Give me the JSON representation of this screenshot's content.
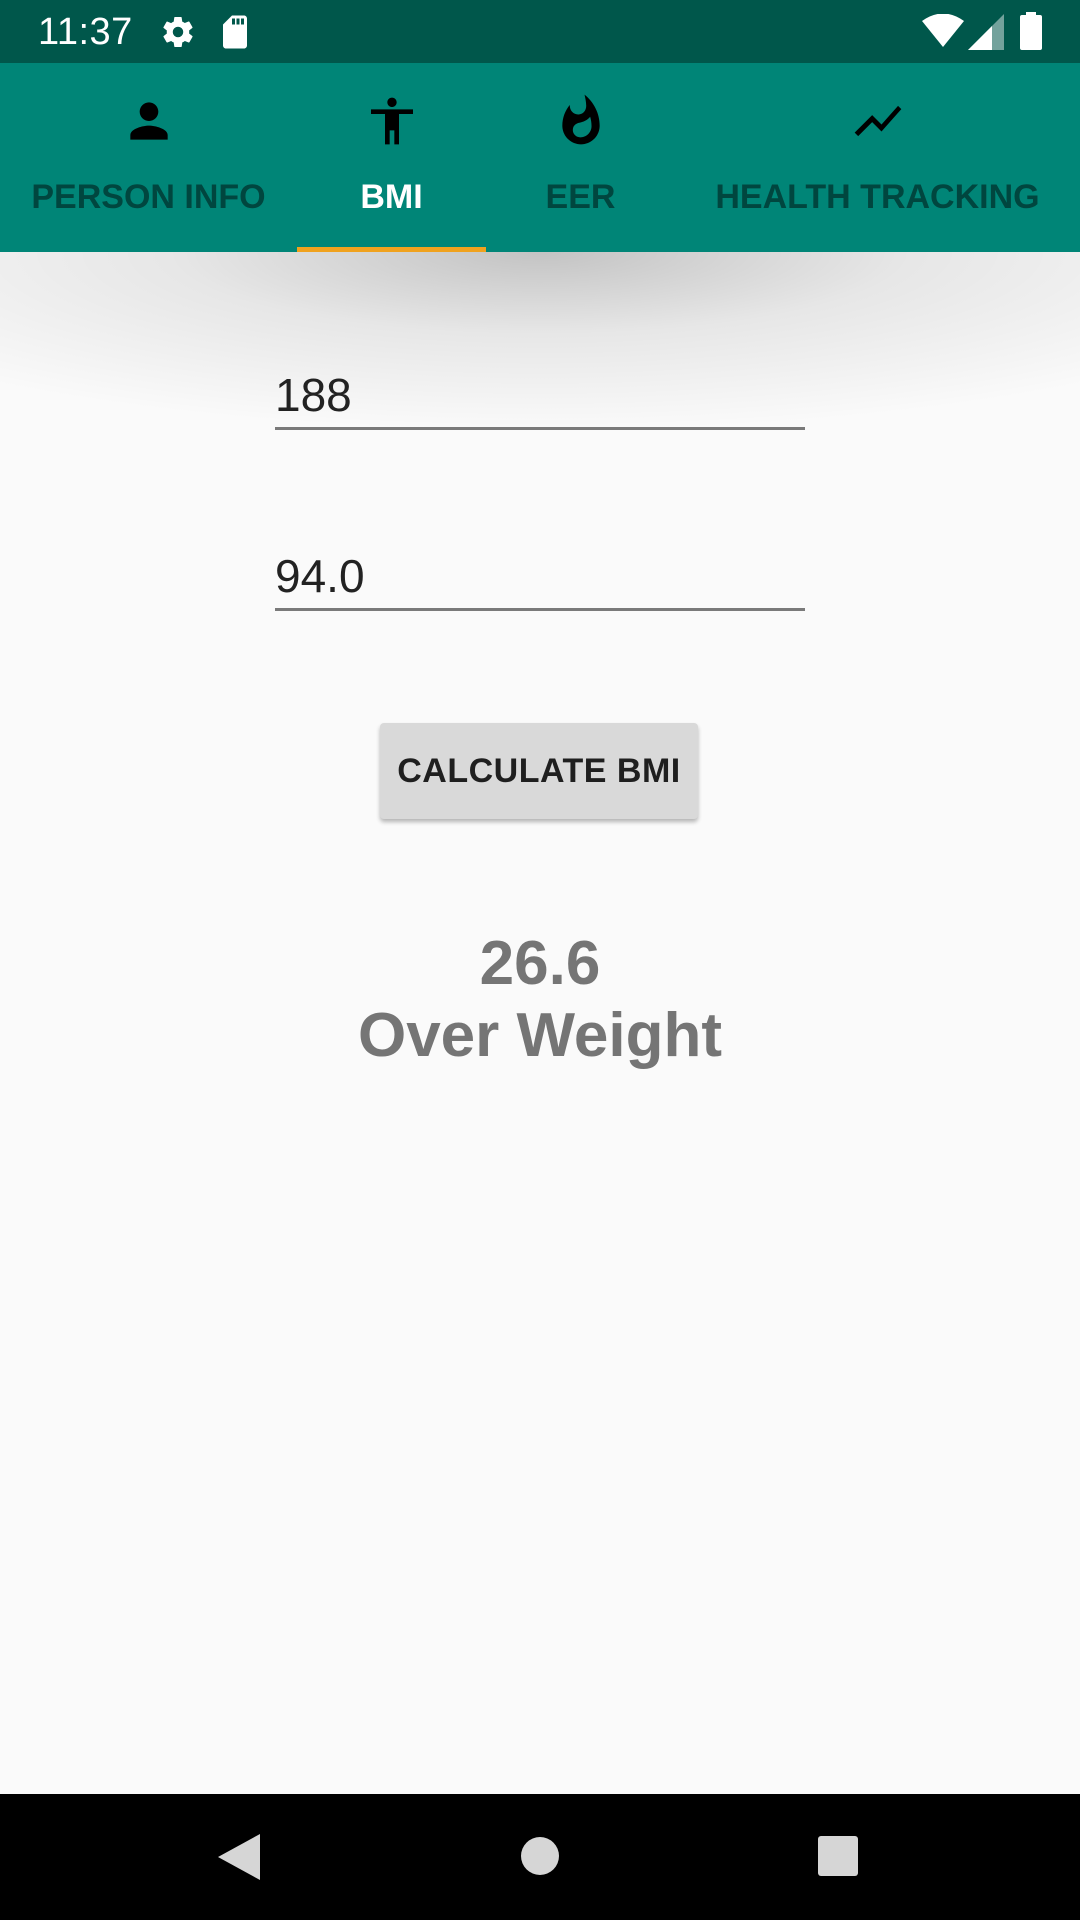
{
  "status_bar": {
    "time": "11:37",
    "icons": [
      "gear-icon",
      "sd-card-icon",
      "wifi-icon",
      "cellular-signal-icon",
      "battery-icon"
    ]
  },
  "tabs": [
    {
      "label": "PERSON INFO",
      "icon": "person-icon",
      "selected": false
    },
    {
      "label": "BMI",
      "icon": "accessibility-icon",
      "selected": true
    },
    {
      "label": "EER",
      "icon": "flame-icon",
      "selected": false
    },
    {
      "label": "HEALTH TRACKING",
      "icon": "trending-up-icon",
      "selected": false
    }
  ],
  "form": {
    "height_value": "188",
    "weight_value": "94.0",
    "calculate_label": "CALCULATE BMI"
  },
  "result": {
    "bmi_value": "26.6",
    "category": "Over Weight"
  },
  "navigation": [
    "back-icon",
    "home-icon",
    "recents-icon"
  ],
  "colors": {
    "status_bar": "#00574b",
    "app_bar": "#008577",
    "tab_indicator": "#f0a21e",
    "background": "#fafafa"
  }
}
